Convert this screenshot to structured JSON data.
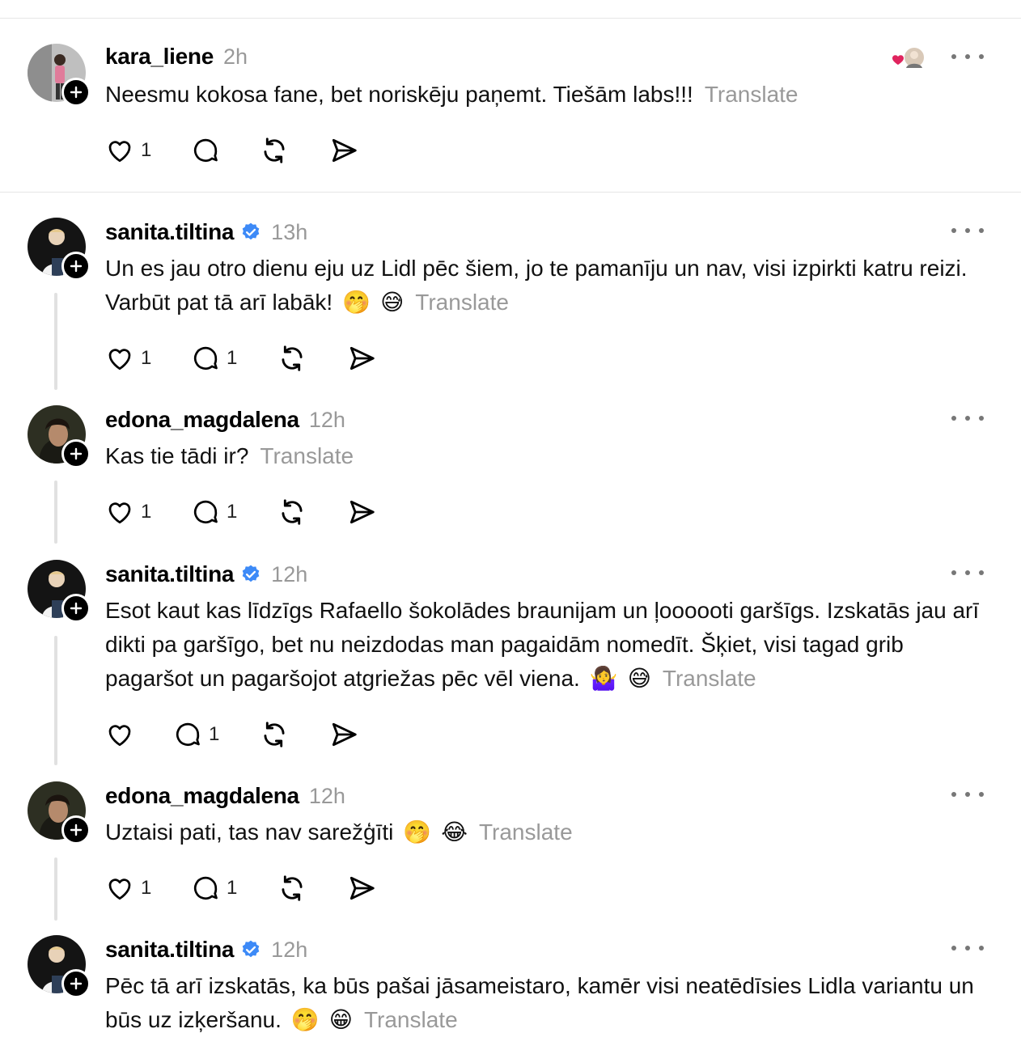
{
  "translate_label": "Translate",
  "posts": [
    {
      "username": "kara_liene",
      "verified": false,
      "time": "2h",
      "text": "Neesmu kokosa fane, bet noriskēju paņemt. Tiešām labs!!!",
      "emojis": [],
      "likes": "1",
      "replies": "",
      "has_reactors": true
    },
    {
      "username": "sanita.tiltina",
      "verified": true,
      "time": "13h",
      "text": "Un es jau otro dienu eju uz Lidl pēc šiem, jo te pamanīju un nav, visi izpirkti katru reizi. Varbūt pat tā arī labāk!",
      "emojis": [
        "🤭",
        "😅"
      ],
      "likes": "1",
      "replies": "1"
    },
    {
      "username": "edona_magdalena",
      "verified": false,
      "time": "12h",
      "text": "Kas tie tādi ir?",
      "emojis": [],
      "likes": "1",
      "replies": "1"
    },
    {
      "username": "sanita.tiltina",
      "verified": true,
      "time": "12h",
      "text": "Esot kaut kas līdzīgs Rafaello šokolādes braunijam un ļoooooti garšīgs. Izskatās jau arī dikti pa garšīgo, bet nu neizdodas man pagaidām nomedīt. Šķiet, visi tagad grib pagaršot un pagaršojot atgriežas pēc vēl viena.",
      "emojis": [
        "🤷‍♀️",
        "😅"
      ],
      "likes": "",
      "replies": "1"
    },
    {
      "username": "edona_magdalena",
      "verified": false,
      "time": "12h",
      "text": "Uztaisi pati, tas nav sarežģīti",
      "emojis": [
        "🤭",
        "😂"
      ],
      "likes": "1",
      "replies": "1"
    },
    {
      "username": "sanita.tiltina",
      "verified": true,
      "time": "12h",
      "text": "Pēc tā arī izskatās, ka būs pašai jāsameistaro, kamēr visi neatēdīsies Lidla variantu un būs uz izķeršanu.",
      "emojis": [
        "🤭",
        "😁"
      ],
      "likes": "",
      "replies": ""
    }
  ],
  "colors": {
    "verified": "#3d8af7",
    "muted": "#999999",
    "separator": "#e6e6e6",
    "heart": "#e0245e"
  }
}
